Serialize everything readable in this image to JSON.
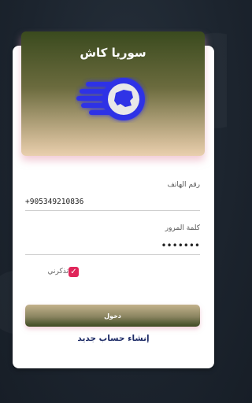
{
  "app": {
    "title": "سوريا كاش"
  },
  "colors": {
    "accent": "#e0265a",
    "brand_dark": "#3a4a1e",
    "brand_light": "#e9cfae",
    "link": "#1d2b66",
    "logo_blue": "#2f33e6"
  },
  "icons": {
    "logo": "speeding-map-logo-icon",
    "checkbox": "check-icon"
  },
  "form": {
    "phone": {
      "label": "رقم الهاتف",
      "value": "+905349210836"
    },
    "password": {
      "label": "كلمة المرور",
      "value": "•••••••"
    },
    "remember": {
      "label": "تذكرني",
      "checked": true
    },
    "login_label": "دخول",
    "signup_label": "إنشاء حساب جديد"
  }
}
